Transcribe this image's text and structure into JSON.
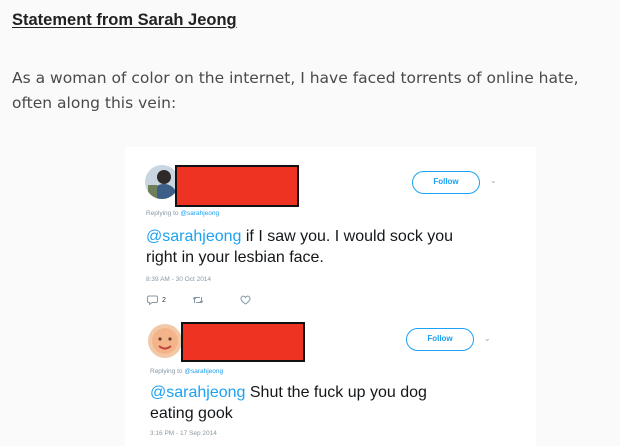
{
  "article": {
    "heading": "Statement from Sarah Jeong",
    "paragraph": "As a woman of color on the internet, I have faced torrents of online hate, often along this vein:"
  },
  "tweets": [
    {
      "follow_label": "Follow",
      "caret": "⌄",
      "replying_label": "Replying to",
      "replying_handle": "@sarahjeong",
      "mention": "@sarahjeong",
      "text_line1": " if I saw you. I would sock you",
      "text_line2": "right in your lesbian face.",
      "timestamp": "8:39 AM - 30 Oct 2014",
      "reply_count": "2"
    },
    {
      "follow_label": "Follow",
      "caret": "⌄",
      "replying_label": "Replying to",
      "replying_handle": "@sarahjeong",
      "mention": "@sarahjeong",
      "text_line1": " Shut the fuck up you dog",
      "text_line2": "eating gook",
      "timestamp": "3:16 PM - 17 Sep 2014"
    }
  ],
  "colors": {
    "page_background": "#fafafa",
    "twitter_blue": "#1da1f2",
    "redaction_red": "#ee3322",
    "muted_gray": "#8899a6"
  },
  "icons": [
    "reply-icon",
    "retweet-icon",
    "heart-icon",
    "chevron-down-icon"
  ]
}
